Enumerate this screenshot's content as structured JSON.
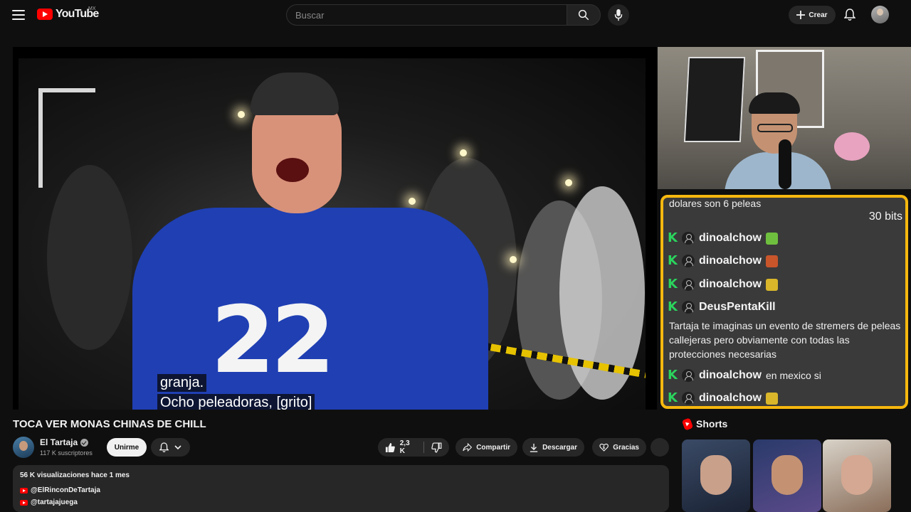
{
  "header": {
    "logo_text": "YouTube",
    "country": "MX",
    "search_placeholder": "Buscar",
    "create_label": "Crear"
  },
  "video": {
    "captions": [
      "granja.",
      "Ocho peleadoras, [grito]"
    ],
    "overlay_chat": {
      "partial_message": "dolares son 6 peleas",
      "bits": "30 bits",
      "rows": [
        {
          "user": "dinoalchow",
          "message": "",
          "emote_color": "#6fbf3f"
        },
        {
          "user": "dinoalchow",
          "message": "",
          "emote_color": "#c9552b"
        },
        {
          "user": "dinoalchow",
          "message": "",
          "emote_color": "#d9b62a"
        },
        {
          "user": "DeusPentaKill",
          "message": "",
          "emote_color": ""
        },
        {
          "user": "dinoalchow",
          "message": "en mexico si",
          "emote_color": ""
        },
        {
          "user": "dinoalchow",
          "message": "",
          "emote_color": "#d9b62a"
        }
      ],
      "long_message": "Tartaja te imaginas un evento de stremers de peleas callejeras pero obviamente con todas las protecciones necesarias"
    }
  },
  "meta": {
    "title": "TOCA VER MONAS CHINAS DE CHILL",
    "channel_name": "El Tartaja",
    "subscribers": "117 K suscriptores",
    "join_label": "Unirme",
    "likes": "2,3 K",
    "share_label": "Compartir",
    "download_label": "Descargar",
    "thanks_label": "Gracias"
  },
  "description": {
    "stats": "56 K visualizaciones  hace 1 mes",
    "links": [
      "@ElRinconDeTartaja",
      "@tartajajuega"
    ]
  },
  "shorts": {
    "heading": "Shorts"
  }
}
